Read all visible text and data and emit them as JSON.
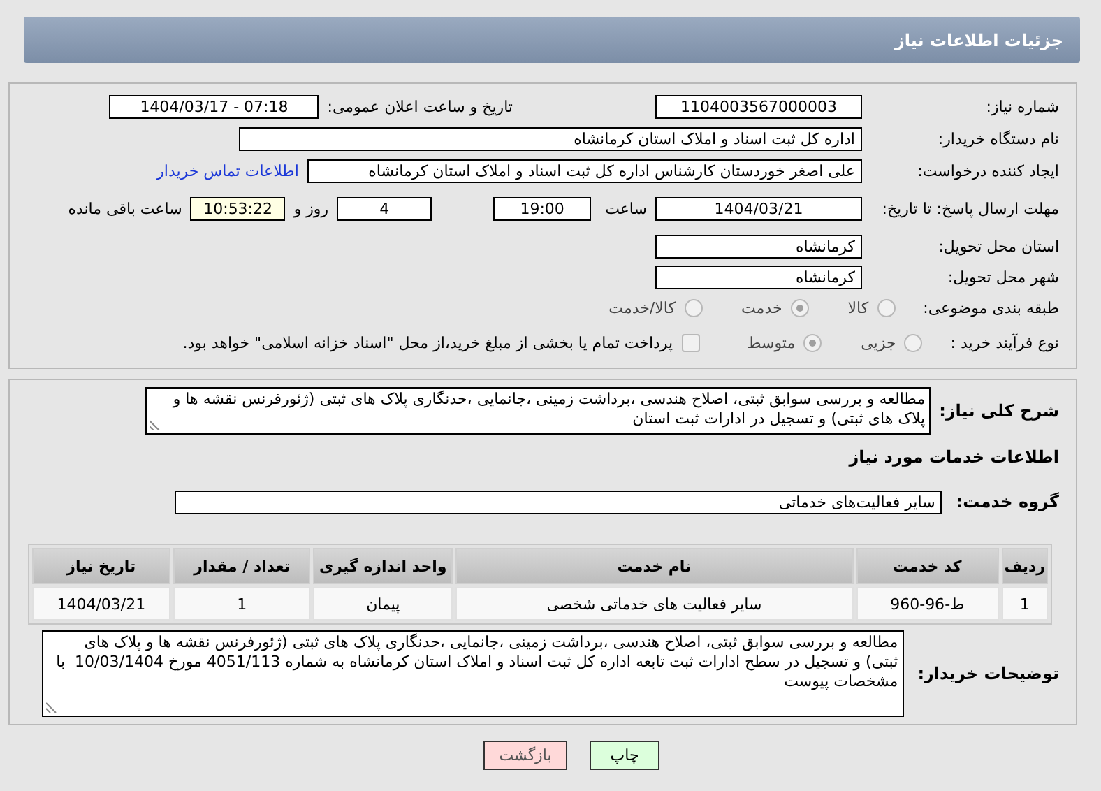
{
  "header": {
    "title": "جزئیات اطلاعات نیاز"
  },
  "need_number": {
    "label": "شماره نیاز:",
    "value": "1104003567000003"
  },
  "announce_date": {
    "label": "تاریخ و ساعت اعلان عمومی:",
    "value": "1404/03/17 - 07:18"
  },
  "buyer_org": {
    "label": "نام دستگاه خریدار:",
    "value": "اداره کل ثبت اسناد و املاک استان کرمانشاه"
  },
  "requester": {
    "label": "ایجاد کننده درخواست:",
    "value": "علی اصغر خوردستان کارشناس اداره کل ثبت اسناد و املاک استان کرمانشاه",
    "link": "اطلاعات تماس خریدار"
  },
  "deadline": {
    "label": "مهلت ارسال پاسخ: تا تاریخ:",
    "date": "1404/03/21",
    "time_label": "ساعت",
    "time": "19:00",
    "days": "4",
    "days_label": "روز و",
    "remaining": "10:53:22",
    "remaining_label": "ساعت باقی مانده"
  },
  "province": {
    "label": "استان محل تحویل:",
    "value": "کرمانشاه"
  },
  "city": {
    "label": "شهر محل تحویل:",
    "value": "کرمانشاه"
  },
  "category": {
    "label": "طبقه بندی موضوعی:",
    "options": [
      {
        "label": "کالا",
        "selected": false
      },
      {
        "label": "خدمت",
        "selected": true
      },
      {
        "label": "کالا/خدمت",
        "selected": false
      }
    ]
  },
  "purchase_type": {
    "label": "نوع فرآیند خرید :",
    "options": [
      {
        "label": "جزیی",
        "selected": false
      },
      {
        "label": "متوسط",
        "selected": true
      }
    ],
    "payment": {
      "label": "پرداخت تمام یا بخشی از مبلغ خرید،از محل \"اسناد خزانه اسلامی\" خواهد بود.",
      "checked": false
    }
  },
  "summary": {
    "label": "شرح کلی نیاز:",
    "value": "مطالعه و بررسی سوابق ثبتی، اصلاح هندسی ،برداشت زمینی ،جانمایی ،حدنگاری پلاک های ثبتی (ژئورفرنس نقشه ها و پلاک های ثبتی) و تسجیل در ادارات ثبت استان"
  },
  "services_heading": "اطلاعات خدمات مورد نیاز",
  "service_group": {
    "label": "گروه خدمت:",
    "value": "سایر فعالیت‌های خدماتی"
  },
  "table": {
    "columns": [
      "ردیف",
      "کد خدمت",
      "نام خدمت",
      "واحد اندازه گیری",
      "تعداد / مقدار",
      "تاریخ نیاز"
    ],
    "rows": [
      [
        "1",
        "ط-96-960",
        "سایر فعالیت های خدماتی شخصی",
        "پیمان",
        "1",
        "1404/03/21"
      ]
    ]
  },
  "buyer_notes": {
    "label": "توضیحات خریدار:",
    "value": "مطالعه و بررسی سوابق ثبتی، اصلاح هندسی ،برداشت زمینی ،جانمایی ،حدنگاری پلاک های ثبتی (ژئورفرنس نقشه ها و پلاک های ثبتی) و تسجیل در سطح ادارات ثبت تابعه اداره کل ثبت اسناد و املاک استان کرمانشاه به شماره 4051/113 مورخ 10/03/1404  با مشخصات پیوست"
  },
  "buttons": [
    {
      "label": "چاپ",
      "kind": "print"
    },
    {
      "label": "بازگشت",
      "kind": "back"
    }
  ]
}
